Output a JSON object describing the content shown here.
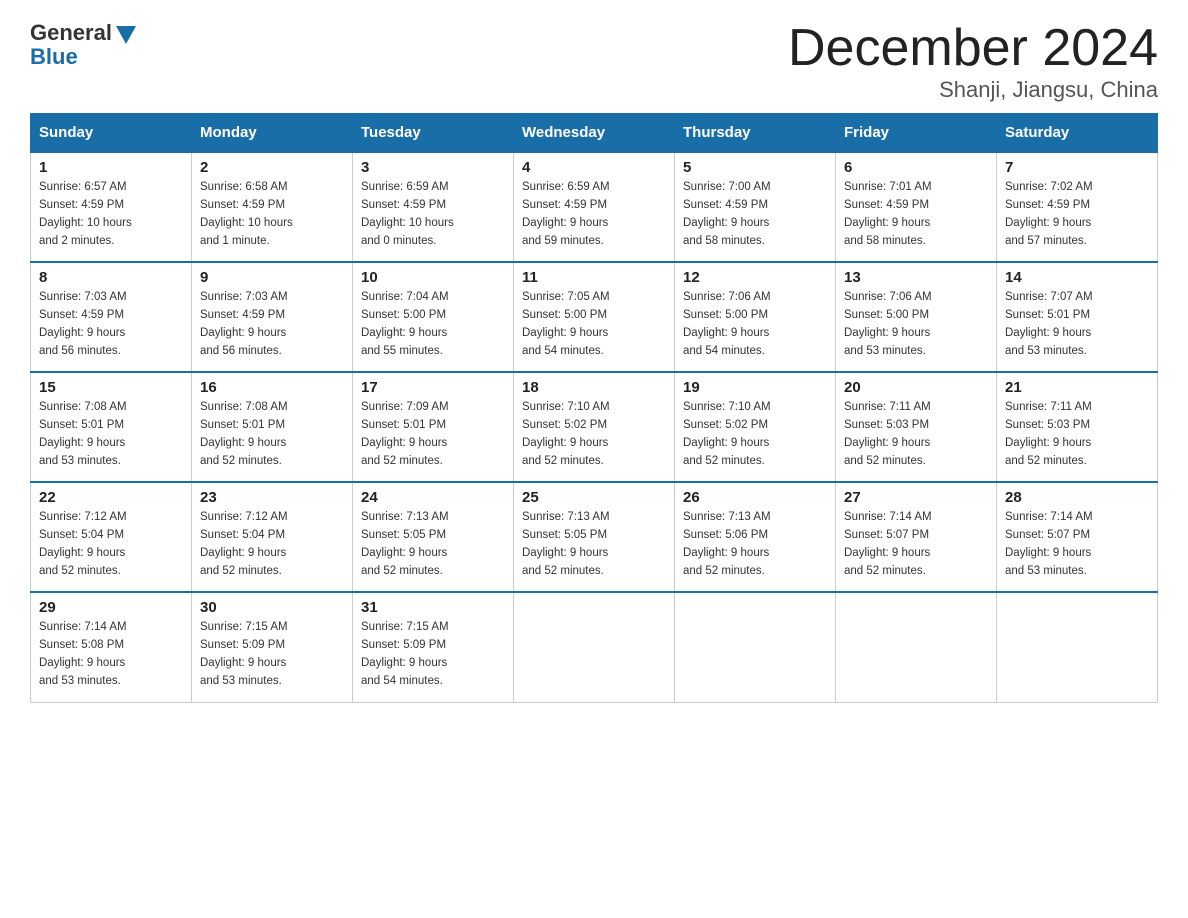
{
  "header": {
    "logo_general": "General",
    "logo_blue": "Blue",
    "month_title": "December 2024",
    "location": "Shanji, Jiangsu, China"
  },
  "days_of_week": [
    "Sunday",
    "Monday",
    "Tuesday",
    "Wednesday",
    "Thursday",
    "Friday",
    "Saturday"
  ],
  "weeks": [
    [
      {
        "day": "1",
        "sunrise": "6:57 AM",
        "sunset": "4:59 PM",
        "daylight": "10 hours and 2 minutes."
      },
      {
        "day": "2",
        "sunrise": "6:58 AM",
        "sunset": "4:59 PM",
        "daylight": "10 hours and 1 minute."
      },
      {
        "day": "3",
        "sunrise": "6:59 AM",
        "sunset": "4:59 PM",
        "daylight": "10 hours and 0 minutes."
      },
      {
        "day": "4",
        "sunrise": "6:59 AM",
        "sunset": "4:59 PM",
        "daylight": "9 hours and 59 minutes."
      },
      {
        "day": "5",
        "sunrise": "7:00 AM",
        "sunset": "4:59 PM",
        "daylight": "9 hours and 58 minutes."
      },
      {
        "day": "6",
        "sunrise": "7:01 AM",
        "sunset": "4:59 PM",
        "daylight": "9 hours and 58 minutes."
      },
      {
        "day": "7",
        "sunrise": "7:02 AM",
        "sunset": "4:59 PM",
        "daylight": "9 hours and 57 minutes."
      }
    ],
    [
      {
        "day": "8",
        "sunrise": "7:03 AM",
        "sunset": "4:59 PM",
        "daylight": "9 hours and 56 minutes."
      },
      {
        "day": "9",
        "sunrise": "7:03 AM",
        "sunset": "4:59 PM",
        "daylight": "9 hours and 56 minutes."
      },
      {
        "day": "10",
        "sunrise": "7:04 AM",
        "sunset": "5:00 PM",
        "daylight": "9 hours and 55 minutes."
      },
      {
        "day": "11",
        "sunrise": "7:05 AM",
        "sunset": "5:00 PM",
        "daylight": "9 hours and 54 minutes."
      },
      {
        "day": "12",
        "sunrise": "7:06 AM",
        "sunset": "5:00 PM",
        "daylight": "9 hours and 54 minutes."
      },
      {
        "day": "13",
        "sunrise": "7:06 AM",
        "sunset": "5:00 PM",
        "daylight": "9 hours and 53 minutes."
      },
      {
        "day": "14",
        "sunrise": "7:07 AM",
        "sunset": "5:01 PM",
        "daylight": "9 hours and 53 minutes."
      }
    ],
    [
      {
        "day": "15",
        "sunrise": "7:08 AM",
        "sunset": "5:01 PM",
        "daylight": "9 hours and 53 minutes."
      },
      {
        "day": "16",
        "sunrise": "7:08 AM",
        "sunset": "5:01 PM",
        "daylight": "9 hours and 52 minutes."
      },
      {
        "day": "17",
        "sunrise": "7:09 AM",
        "sunset": "5:01 PM",
        "daylight": "9 hours and 52 minutes."
      },
      {
        "day": "18",
        "sunrise": "7:10 AM",
        "sunset": "5:02 PM",
        "daylight": "9 hours and 52 minutes."
      },
      {
        "day": "19",
        "sunrise": "7:10 AM",
        "sunset": "5:02 PM",
        "daylight": "9 hours and 52 minutes."
      },
      {
        "day": "20",
        "sunrise": "7:11 AM",
        "sunset": "5:03 PM",
        "daylight": "9 hours and 52 minutes."
      },
      {
        "day": "21",
        "sunrise": "7:11 AM",
        "sunset": "5:03 PM",
        "daylight": "9 hours and 52 minutes."
      }
    ],
    [
      {
        "day": "22",
        "sunrise": "7:12 AM",
        "sunset": "5:04 PM",
        "daylight": "9 hours and 52 minutes."
      },
      {
        "day": "23",
        "sunrise": "7:12 AM",
        "sunset": "5:04 PM",
        "daylight": "9 hours and 52 minutes."
      },
      {
        "day": "24",
        "sunrise": "7:13 AM",
        "sunset": "5:05 PM",
        "daylight": "9 hours and 52 minutes."
      },
      {
        "day": "25",
        "sunrise": "7:13 AM",
        "sunset": "5:05 PM",
        "daylight": "9 hours and 52 minutes."
      },
      {
        "day": "26",
        "sunrise": "7:13 AM",
        "sunset": "5:06 PM",
        "daylight": "9 hours and 52 minutes."
      },
      {
        "day": "27",
        "sunrise": "7:14 AM",
        "sunset": "5:07 PM",
        "daylight": "9 hours and 52 minutes."
      },
      {
        "day": "28",
        "sunrise": "7:14 AM",
        "sunset": "5:07 PM",
        "daylight": "9 hours and 53 minutes."
      }
    ],
    [
      {
        "day": "29",
        "sunrise": "7:14 AM",
        "sunset": "5:08 PM",
        "daylight": "9 hours and 53 minutes."
      },
      {
        "day": "30",
        "sunrise": "7:15 AM",
        "sunset": "5:09 PM",
        "daylight": "9 hours and 53 minutes."
      },
      {
        "day": "31",
        "sunrise": "7:15 AM",
        "sunset": "5:09 PM",
        "daylight": "9 hours and 54 minutes."
      },
      null,
      null,
      null,
      null
    ]
  ]
}
